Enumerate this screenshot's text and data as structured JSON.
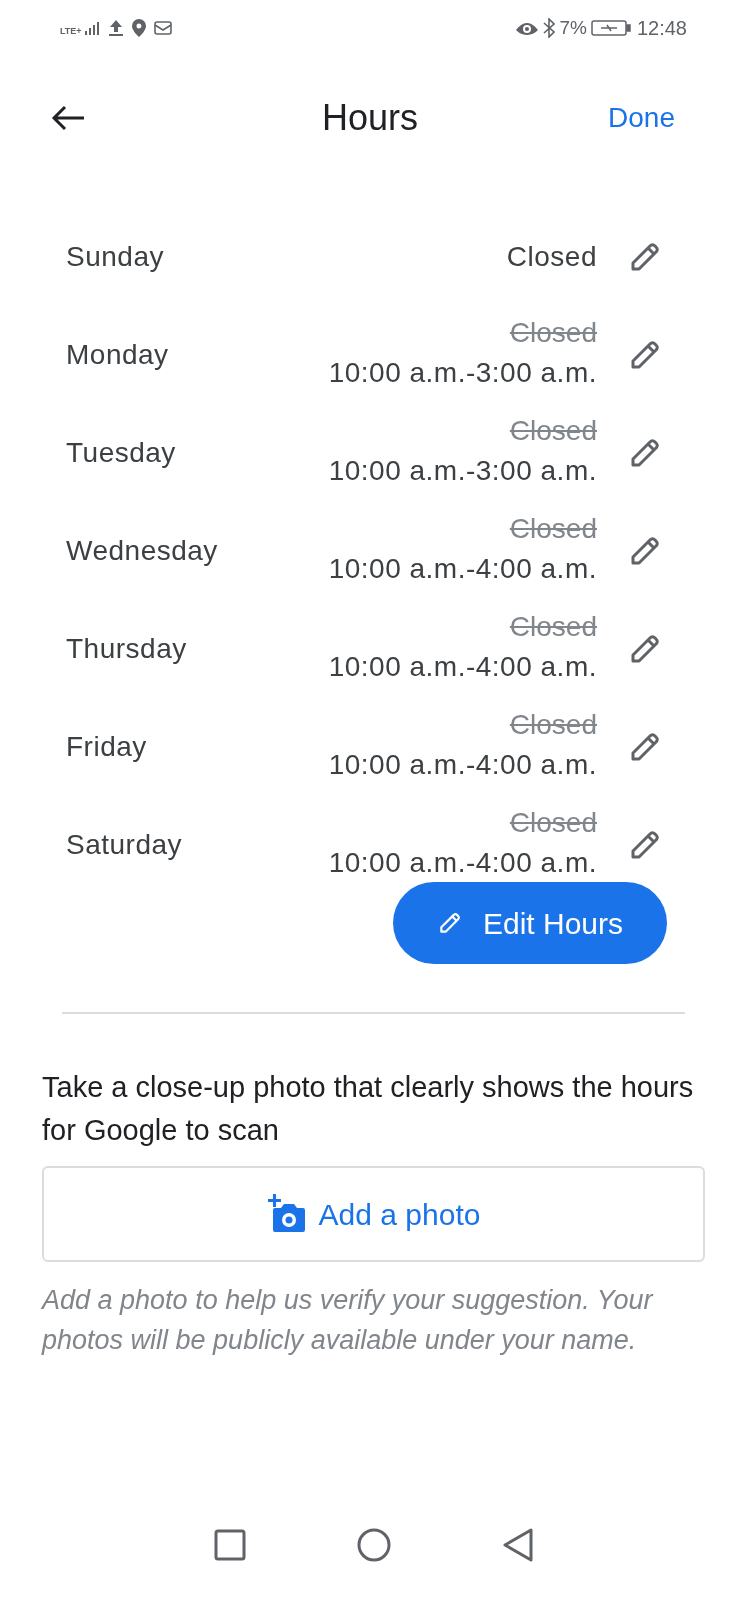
{
  "status_bar": {
    "network": "LTE+",
    "battery": "7%",
    "time": "12:48"
  },
  "header": {
    "title": "Hours",
    "action": "Done"
  },
  "days": [
    {
      "name": "Sunday",
      "hours": "Closed"
    },
    {
      "name": "Monday",
      "previous": "Closed",
      "hours": "10:00 a.m.-3:00 a.m."
    },
    {
      "name": "Tuesday",
      "previous": "Closed",
      "hours": "10:00 a.m.-3:00 a.m."
    },
    {
      "name": "Wednesday",
      "previous": "Closed",
      "hours": "10:00 a.m.-4:00 a.m."
    },
    {
      "name": "Thursday",
      "previous": "Closed",
      "hours": "10:00 a.m.-4:00 a.m."
    },
    {
      "name": "Friday",
      "previous": "Closed",
      "hours": "10:00 a.m.-4:00 a.m."
    },
    {
      "name": "Saturday",
      "previous": "Closed",
      "hours": "10:00 a.m.-4:00 a.m."
    }
  ],
  "edit_button": "Edit Hours",
  "photo_prompt": "Take a close-up photo that clearly shows the hours for Google to scan",
  "add_photo_button": "Add a photo",
  "note": "Add a photo to help us verify your suggestion. Your photos will be publicly available under your name."
}
